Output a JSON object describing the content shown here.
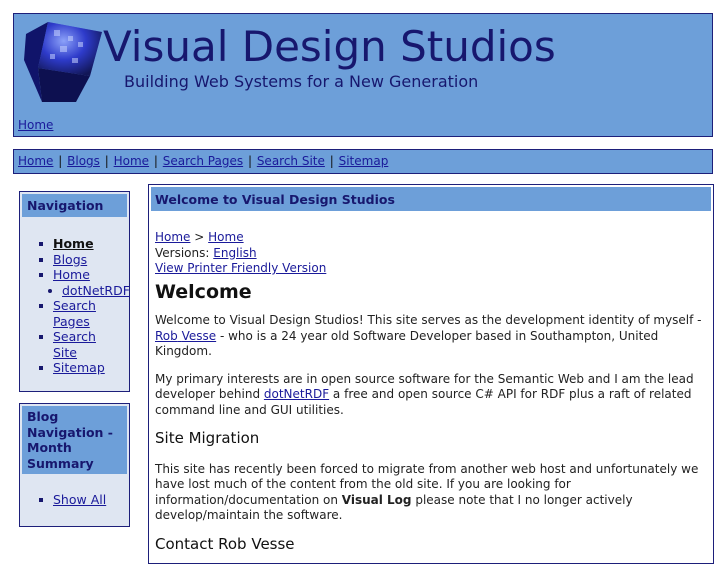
{
  "header": {
    "title": "Visual Design Studios",
    "tagline": "Building Web Systems for a New Generation",
    "home_link": "Home"
  },
  "topnav": {
    "links": [
      "Home",
      "Blogs",
      "Home",
      "Search Pages",
      "Search Site",
      "Sitemap"
    ],
    "separator": "|"
  },
  "sidebar": {
    "navigation": {
      "title": "Navigation",
      "items": [
        {
          "label": "Home",
          "bold": true
        },
        {
          "label": "Blogs"
        },
        {
          "label": "Home"
        },
        {
          "label": "dotNetRDF",
          "sub": true
        },
        {
          "label": "Search"
        },
        {
          "label": "Pages"
        },
        {
          "label": "Search"
        },
        {
          "label": "Site"
        },
        {
          "label": "Sitemap"
        }
      ]
    },
    "blog_nav": {
      "title_lines": [
        "Blog",
        "Navigation -",
        "Month",
        "Summary"
      ],
      "show_all": "Show All"
    }
  },
  "main": {
    "title": "Welcome to Visual Design Studios",
    "breadcrumb": {
      "first": "Home",
      "sep": ">",
      "second": "Home"
    },
    "versions_label": "Versions:",
    "versions_link": "English",
    "printer_link": "View Printer Friendly Version",
    "heading": "Welcome",
    "intro_before": "Welcome to Visual Design Studios! This site serves as the development identity of myself - ",
    "intro_name_a": "Rob",
    "intro_name_b": "Vesse",
    "intro_after": " - who is a 24 year old Software Developer based in Southampton, United Kingdom.",
    "interest_before": "My primary interests are in open source software for the Semantic Web and I am the lead developer behind ",
    "interest_link": "dotNetRDF",
    "interest_after": " a free and open source C# API for RDF plus a raft of related command line and GUI utilities.",
    "migration_heading": "Site Migration",
    "migration_before": "This site has recently been forced to migrate from another web host and unfortunately we have lost much of the content from the old site. If you are looking for information/documentation on ",
    "migration_bold": "Visual Log",
    "migration_after": " please note that I no longer actively develop/maintain the software.",
    "contact_heading": "Contact Rob Vesse"
  }
}
